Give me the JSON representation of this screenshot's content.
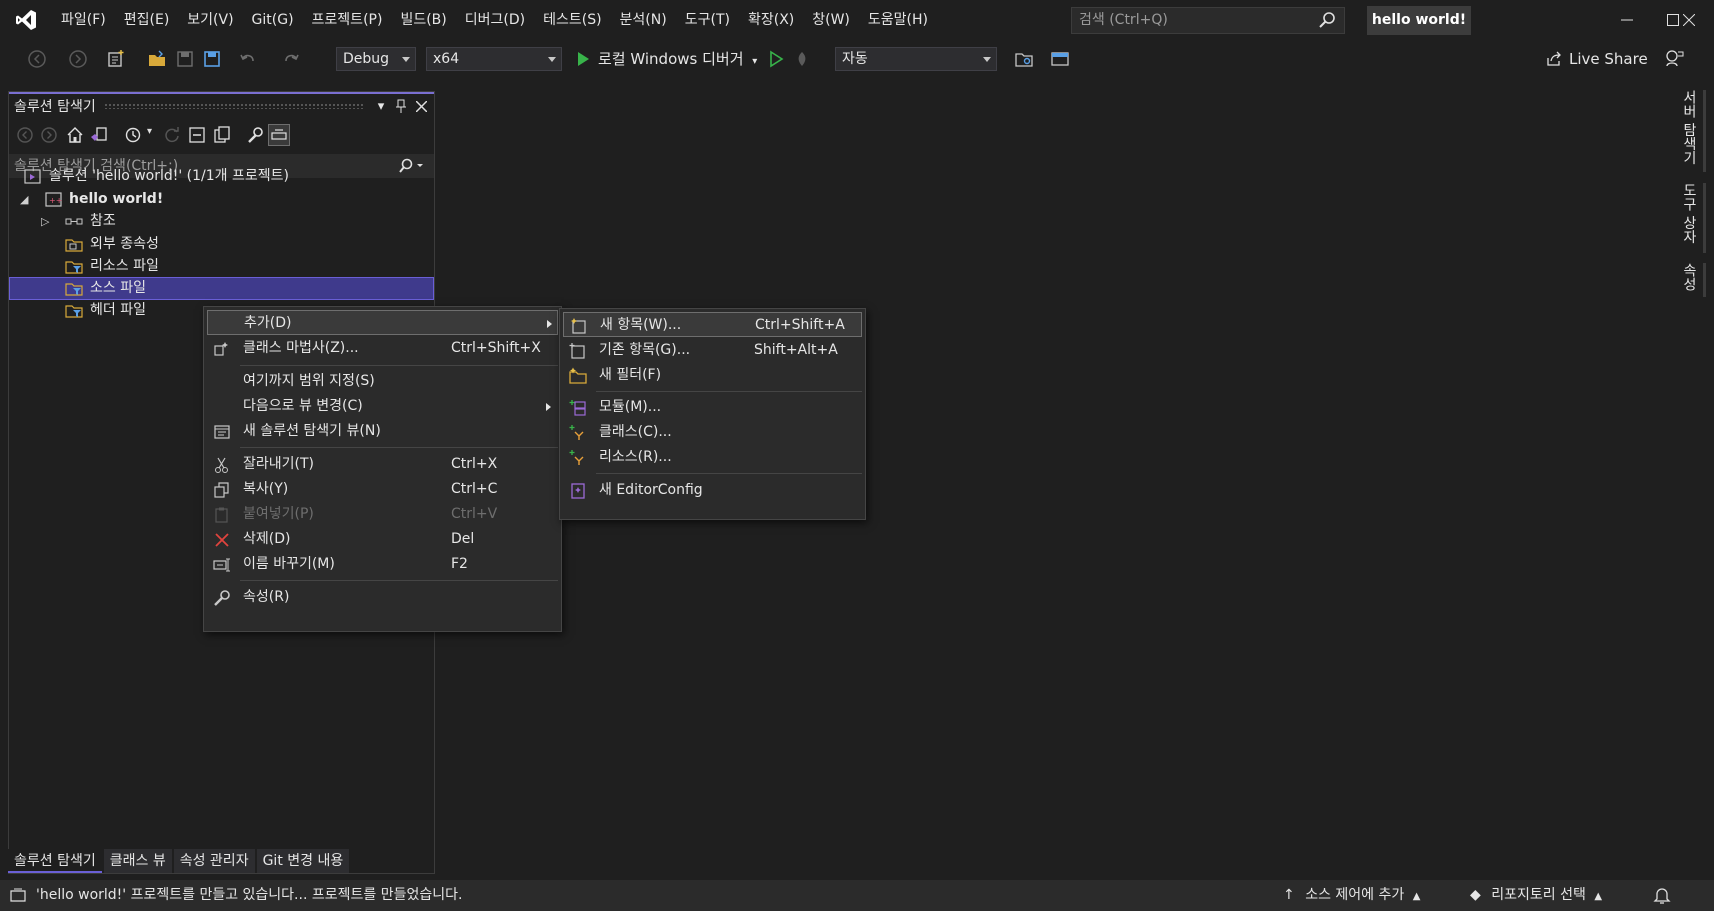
{
  "menu": [
    "파일(F)",
    "편집(E)",
    "보기(V)",
    "Git(G)",
    "프로젝트(P)",
    "빌드(B)",
    "디버그(D)",
    "테스트(S)",
    "분석(N)",
    "도구(T)",
    "확장(X)",
    "창(W)",
    "도움말(H)"
  ],
  "search": {
    "placeholder": "검색 (Ctrl+Q)"
  },
  "window_title": "hello world!",
  "toolbar": {
    "config": "Debug",
    "platform": "x64",
    "debugger": "로컬 Windows 디버거",
    "startup": "자동",
    "live_share": "Live Share"
  },
  "solution_explorer": {
    "title": "솔루션 탐색기",
    "search_placeholder": "솔루션 탐색기 검색(Ctrl+;)",
    "tree": [
      {
        "label": "솔루션 'hello world!' (1/1개 프로젝트)",
        "icon": "solution-icon"
      },
      {
        "label": "hello world!",
        "icon": "project-icon",
        "bold": true
      },
      {
        "label": "참조",
        "icon": "references-icon"
      },
      {
        "label": "외부 종속성",
        "icon": "external-deps-icon"
      },
      {
        "label": "리소스 파일",
        "icon": "filter-folder-icon"
      },
      {
        "label": "소스 파일",
        "icon": "filter-folder-icon",
        "selected": true
      },
      {
        "label": "헤더 파일",
        "icon": "filter-folder-icon"
      }
    ]
  },
  "bottom_tabs": [
    "솔루션 탐색기",
    "클래스 뷰",
    "속성 관리자",
    "Git 변경 내용"
  ],
  "side_tabs": [
    "서버 탐색기",
    "도구 상자",
    "속성"
  ],
  "context_menu": [
    {
      "label": "추가(D)",
      "shortcut": "",
      "submenu": true,
      "highlighted": true
    },
    {
      "label": "클래스 마법사(Z)...",
      "shortcut": "Ctrl+Shift+X",
      "icon": "class-wizard-icon"
    },
    {
      "label": "여기까지 범위 지정(S)",
      "shortcut": ""
    },
    {
      "label": "다음으로 뷰 변경(C)",
      "shortcut": "",
      "submenu": true
    },
    {
      "label": "새 솔루션 탐색기 뷰(N)",
      "shortcut": "",
      "icon": "new-view-icon"
    },
    {
      "label": "잘라내기(T)",
      "shortcut": "Ctrl+X",
      "icon": "cut-icon"
    },
    {
      "label": "복사(Y)",
      "shortcut": "Ctrl+C",
      "icon": "copy-icon"
    },
    {
      "label": "붙여넣기(P)",
      "shortcut": "Ctrl+V",
      "icon": "paste-icon",
      "disabled": true
    },
    {
      "label": "삭제(D)",
      "shortcut": "Del",
      "icon": "delete-icon"
    },
    {
      "label": "이름 바꾸기(M)",
      "shortcut": "F2",
      "icon": "rename-icon"
    },
    {
      "label": "속성(R)",
      "shortcut": "",
      "icon": "wrench-icon"
    }
  ],
  "submenu": [
    {
      "label": "새 항목(W)...",
      "shortcut": "Ctrl+Shift+A",
      "icon": "new-item-icon"
    },
    {
      "label": "기존 항목(G)...",
      "shortcut": "Shift+Alt+A",
      "icon": "existing-item-icon"
    },
    {
      "label": "새 필터(F)",
      "shortcut": "",
      "icon": "new-filter-icon"
    },
    {
      "label": "모듈(M)...",
      "shortcut": "",
      "icon": "module-icon"
    },
    {
      "label": "클래스(C)...",
      "shortcut": "",
      "icon": "class-icon"
    },
    {
      "label": "리소스(R)...",
      "shortcut": "",
      "icon": "resource-icon"
    },
    {
      "label": "새 EditorConfig",
      "shortcut": "",
      "icon": "editorconfig-icon"
    }
  ],
  "status": {
    "message": "'hello world!' 프로젝트를 만들고 있습니다... 프로젝트를 만들었습니다.",
    "source_control": "소스 제어에 추가",
    "repository": "리포지토리 선택"
  },
  "colors": {
    "accent": "#6a5fd6",
    "selection": "#3f3a8c",
    "background": "#1f1f1f",
    "menu_bg": "#2b2b2b"
  }
}
